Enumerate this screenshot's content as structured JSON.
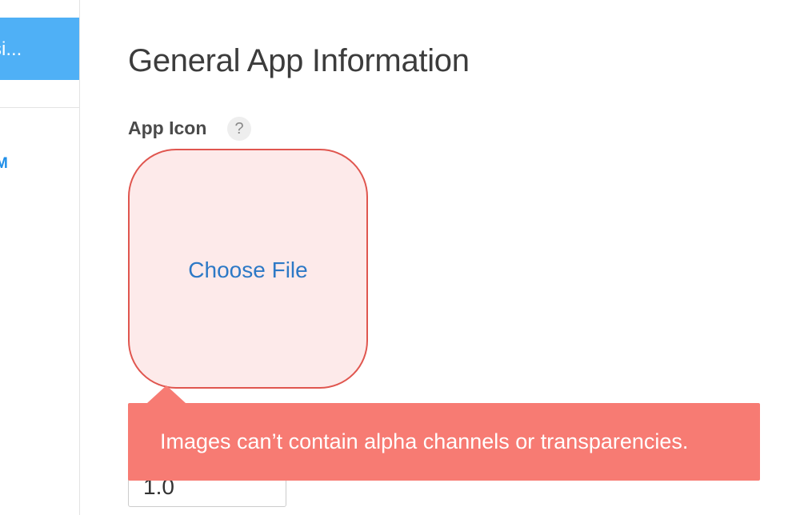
{
  "sidebar": {
    "active_item_label": "si...",
    "link_label": "M"
  },
  "main": {
    "title": "General App Information",
    "app_icon": {
      "label": "App Icon",
      "help_glyph": "?",
      "choose_file_label": "Choose File",
      "error_message": "Images can’t contain alpha channels or transparencies."
    },
    "version_field": {
      "value": "1.0"
    }
  },
  "colors": {
    "sidebar_active": "#4fb0f6",
    "link": "#1f8ee8",
    "choose_file": "#2d79c6",
    "drop_border": "#e0564f",
    "drop_fill": "#fdeaea",
    "error_bg": "#f77b73"
  }
}
